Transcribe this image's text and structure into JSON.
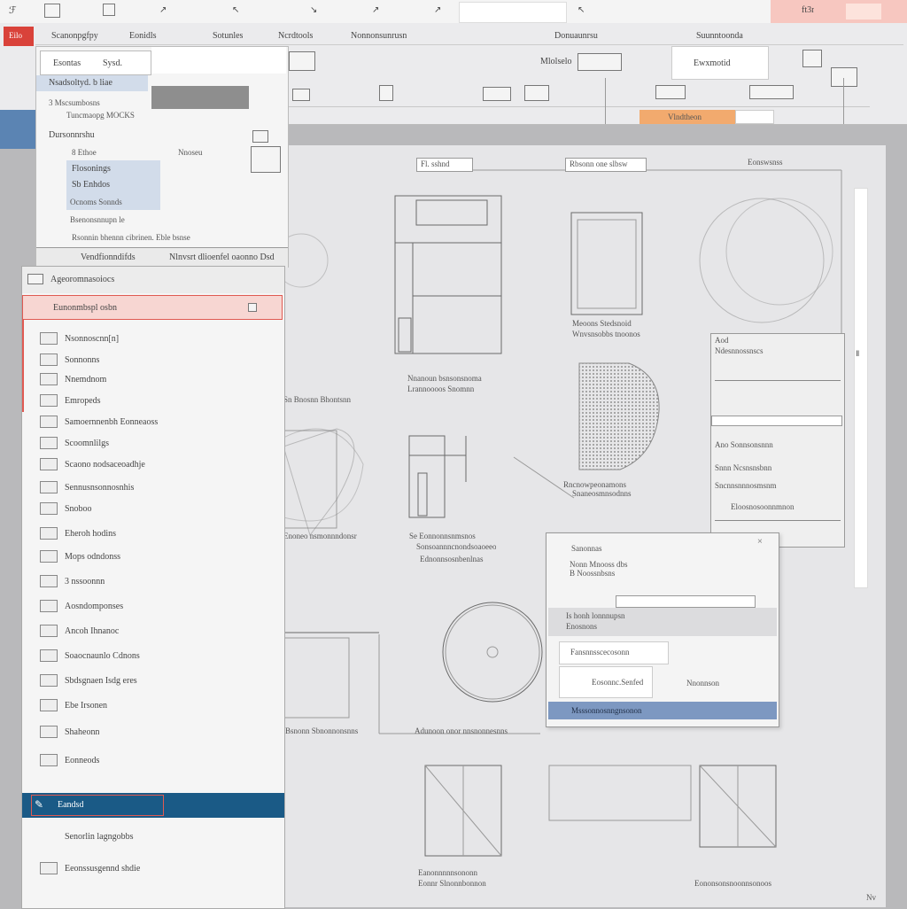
{
  "colors": {
    "accent": "#e05a52",
    "selection": "#1a5a86",
    "highlight_tab": "#f2aa6e",
    "panel_bg": "#f5f5f5",
    "canvas_bg": "#e6e6e6",
    "blue_bar": "#7d98c1"
  },
  "title_bar": {
    "left_glyph": "ℱ",
    "icons": [
      "document-icon",
      "grid-icon",
      "arrow-icon",
      "arrow-icon",
      "arrow-icon",
      "arrow-icon",
      "arrow-icon"
    ],
    "right_label": "ft3r"
  },
  "ribbon": {
    "app_button": "Eilo",
    "tabs": [
      "Scanonpgfpy",
      "Eonidls",
      "Sotunles",
      "Ncrdtools",
      "Nonnonsunrusn",
      "Donuaunrsu",
      "Suunntoonda"
    ],
    "group_items": [
      "Mlolselo",
      "Ewxmotid"
    ],
    "status_tab": "Vlndtheon"
  },
  "top_panel": {
    "search_label": "Esontas",
    "search_value": "Sysd.",
    "items": [
      "Nsadsoltyd. b liae",
      "3 Mscsumbosns",
      "Tuncmaopg MOCKS",
      "Dursonnrshu",
      "8 Ethoe",
      "Flosonings",
      "Sb Enhdos",
      "Ocnoms Sonnds",
      "Bsenonsnnupn le",
      "Rsonnin bhennn cibrinen. Eble bsnse"
    ],
    "side_label": "Nnoseu",
    "footer_left": "Vendfionndifds",
    "footer_right": "Nlnvsrt dlioenfel oaonno Dsd"
  },
  "left_panel": {
    "header": "Ageoromnasoiocs",
    "selected_top": "Eunonmbspl osbn",
    "items": [
      "Nsonnoscnn[n]",
      "Sonnonns",
      "Nnemdnom",
      "Emropeds",
      "Samoernnenbh Eonneaoss",
      "Scoomnlilgs",
      "Scaono nodsaceoadhje",
      "Sennusnsonnosnhis",
      "Snoboo",
      "Eheroh hodins",
      "Mops odndonss",
      "3 nssoonnn",
      "Aosndomponses",
      "Ancoh Ihnanoc",
      "Soaocnaunlo Cdnons",
      "Sbdsgnaen Isdg eres",
      "Ebe Irsonen",
      "Shaheonn",
      "Eonneods",
      "Eandsd",
      "Senorlin lagngobbs",
      "Eeonssusgennd shdie"
    ],
    "selected_item": "Eandsd"
  },
  "canvas": {
    "toolbar_left": "Fl. sshnd",
    "toolbar_right": "Rbsonn one slbsw",
    "ruler_label": "Eonswsnss",
    "captions": [
      "Meoons Stedsnoid",
      "Wnvsnsobbs tnoonos",
      "Nnanoun bsnsonsnoma",
      "Lrannoooos Snomnn",
      "Sn Bnosnn Bhontsnn",
      "Rncnowpeonamons",
      "Snaneosmnsodnns",
      "Se Eonnonnsnmsnos",
      "Sonsoannncnondsoaoeeo",
      "Ednonnsosnbenlnas",
      "Enoneo nsmonnndonsr",
      "Adunoon onor nnsnonnesnns",
      "Bsnonn Sbnonnonsnns",
      "Eanonnnnnsononn",
      "Eonnr Slnonnbonnon",
      "Eononsonsnoonnsonoos"
    ],
    "corner_label": "Nv"
  },
  "properties_panel": {
    "title": "Aod",
    "items": [
      "Ndesnnossnscs",
      "Ano Sonnsonsnnn",
      "Snnn Ncsnsnsbnn",
      "Sncnnsnnnosmsnm",
      "Eloosnosoonnmnon"
    ]
  },
  "dialog": {
    "title": "Sanonnas",
    "lines": [
      "Nonn Mnooss dbs",
      "B Noossnbsns"
    ],
    "option_label": "Is honh lonnnupsn",
    "option_sub": "Enosnons",
    "field_label": "Fansnnsscecosonn",
    "action_label": "Eosonnc.Senfed",
    "cancel_label": "Nnonnson",
    "footer_label": "Msssonnosnngnsonon"
  }
}
